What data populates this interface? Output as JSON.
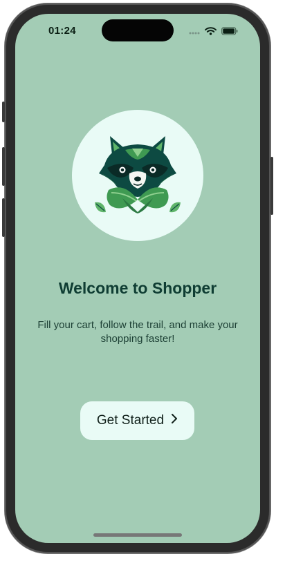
{
  "status_bar": {
    "time": "01:24",
    "icons": [
      "signal-dots-icon",
      "wifi-icon",
      "battery-icon"
    ]
  },
  "logo": {
    "icon": "raccoon-leaf-logo-icon"
  },
  "welcome": {
    "title": "Welcome to Shopper",
    "subtitle": "Fill your cart, follow the trail, and make your shopping faster!"
  },
  "cta": {
    "label": "Get Started",
    "icon": "chevron-right-icon"
  },
  "colors": {
    "screen_background": "#a3ccb5",
    "card_background": "#e9fbf6",
    "title_color": "#0f3d33",
    "logo_green": "#3f9a52",
    "logo_dark": "#0d4a42"
  }
}
